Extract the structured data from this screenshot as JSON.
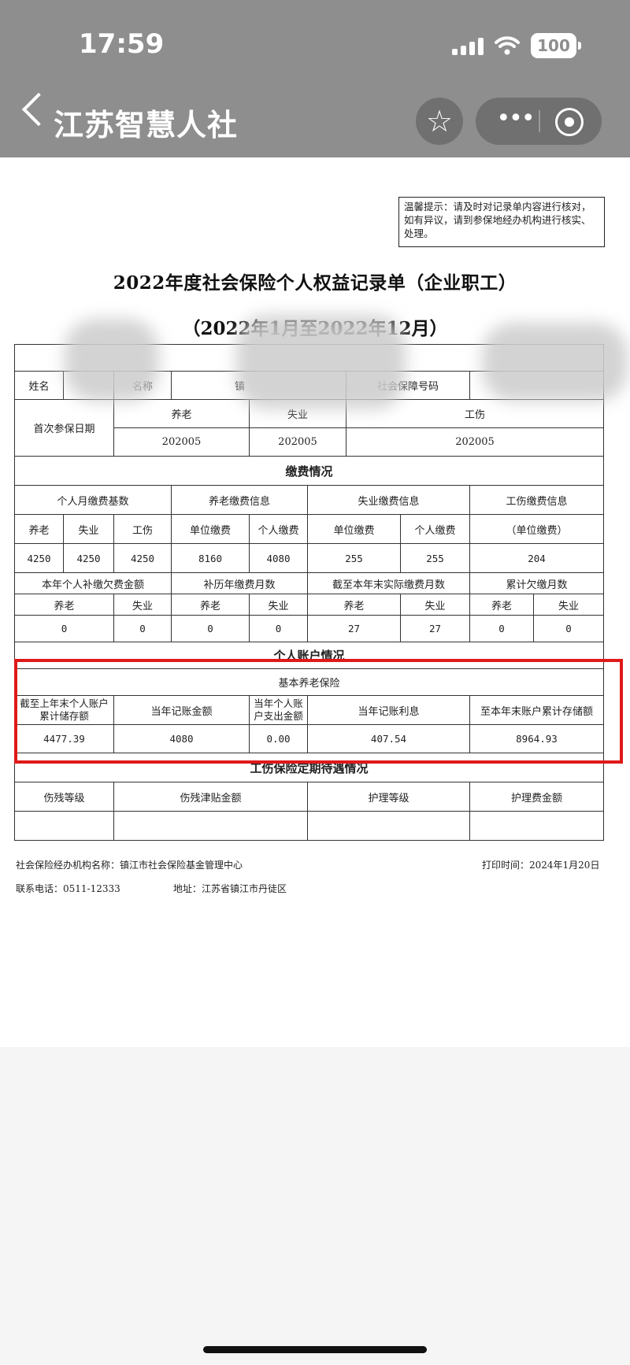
{
  "status": {
    "time": "17:59",
    "battery": "100"
  },
  "nav": {
    "title": "江苏智慧人社"
  },
  "icons": {
    "back": "back-chevron-icon",
    "star": "star-icon",
    "more": "more-dots-icon",
    "close": "mini-program-close-icon"
  },
  "colors": {
    "highlight": "#e01919",
    "topbar": "#8e8e8e"
  },
  "doc": {
    "notice": "温馨提示：请及时对记录单内容进行核对，如有异议，请到参保地经办机构进行核实、处理。",
    "title": "2022年度社会保险个人权益记录单（企业职工）",
    "period": "（2022年1月至2022年12月）",
    "info": {
      "name_label": "姓名",
      "unit_label": "名称",
      "unit_value": "镇",
      "ssn_label": "社会保障号码",
      "first_date_label": "首次参保日期",
      "pension": "养老",
      "unemployment": "失业",
      "injury": "工伤",
      "first_dates": [
        "202005",
        "202005",
        "202005"
      ]
    },
    "payment": {
      "section": "缴费情况",
      "base_header": "个人月缴费基数",
      "pension_info": "养老缴费信息",
      "unemployment_info": "失业缴费信息",
      "injury_info": "工伤缴费信息",
      "sub": {
        "pension": "养老",
        "unemployment": "失业",
        "injury": "工伤",
        "unit_pay": "单位缴费",
        "personal_pay": "个人缴费",
        "injury_unit": "（单位缴费）"
      },
      "values": [
        "4250",
        "4250",
        "4250",
        "8160",
        "4080",
        "255",
        "255",
        "204"
      ],
      "supp_header": "本年个人补缴欠费金额",
      "makeup_header": "补历年缴费月数",
      "actual_header": "截至本年末实际缴费月数",
      "arrears_header": "累计欠缴月数",
      "pairs": [
        "养老",
        "失业",
        "养老",
        "失业",
        "养老",
        "失业",
        "养老",
        "失业"
      ],
      "pair_values": [
        "0",
        "0",
        "0",
        "0",
        "27",
        "27",
        "0",
        "0"
      ]
    },
    "account": {
      "section": "个人账户情况",
      "sub_section": "基本养老保险",
      "headers": [
        "截至上年末个人账户累计储存额",
        "当年记账金额",
        "当年个人账户支出金额",
        "当年记账利息",
        "至本年末账户累计存储额"
      ],
      "values": [
        "4477.39",
        "4080",
        "0.00",
        "407.54",
        "8964.93"
      ]
    },
    "injury_benefit": {
      "section": "工伤保险定期待遇情况",
      "headers": [
        "伤残等级",
        "伤残津贴金额",
        "护理等级",
        "护理费金额"
      ]
    },
    "footer": {
      "agency": "社会保险经办机构名称：镇江市社会保险基金管理中心",
      "print_time": "打印时间：2024年1月20日",
      "phone": "联系电话：0511-12333",
      "address": "地址：江苏省镇江市丹徒区"
    }
  }
}
